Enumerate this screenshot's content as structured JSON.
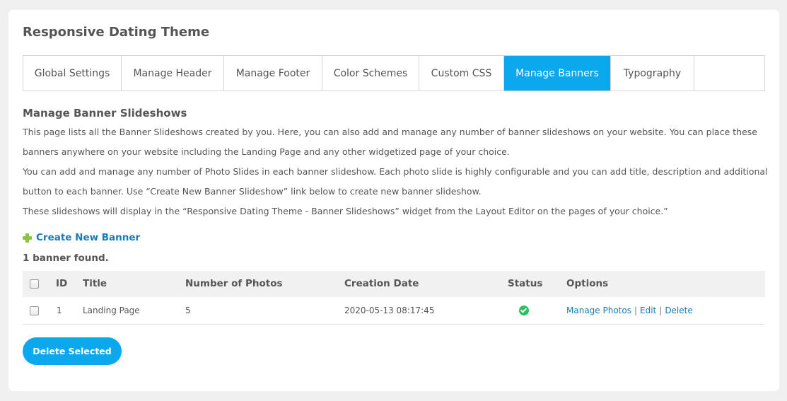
{
  "page_title": "Responsive Dating Theme",
  "tabs": [
    {
      "label": "Global Settings",
      "active": false
    },
    {
      "label": "Manage Header",
      "active": false
    },
    {
      "label": "Manage Footer",
      "active": false
    },
    {
      "label": "Color Schemes",
      "active": false
    },
    {
      "label": "Custom CSS",
      "active": false
    },
    {
      "label": "Manage Banners",
      "active": true
    },
    {
      "label": "Typography",
      "active": false
    }
  ],
  "section": {
    "title": "Manage Banner Slideshows",
    "description": [
      "This page lists all the Banner Slideshows created by you. Here, you can also add and manage any number of banner slideshows on your website. You can place these",
      "banners anywhere on your website including the Landing Page and any other widgetized page of your choice.",
      "You can add and manage any number of Photo Slides in each banner slideshow. Each photo slide is highly configurable and you can add title, description and additional",
      "button to each banner. Use “Create New Banner Slideshow” link below to create new banner slideshow.",
      "These slideshows will display in the “Responsive Dating Theme - Banner Slideshows” widget from the Layout Editor on the pages of your choice.”"
    ]
  },
  "create_link": {
    "label": "Create New Banner",
    "icon": "plus-icon"
  },
  "found_text": "1 banner found.",
  "table": {
    "headers": {
      "id": "ID",
      "title": "Title",
      "photos": "Number of Photos",
      "date": "Creation Date",
      "status": "Status",
      "options": "Options"
    },
    "rows": [
      {
        "id": "1",
        "title": "Landing Page",
        "photos": "5",
        "date": "2020-05-13 08:17:45",
        "status": "enabled",
        "options": [
          "Manage Photos",
          "Edit",
          "Delete"
        ],
        "separator": "|"
      }
    ]
  },
  "delete_button": "Delete Selected",
  "colors": {
    "accent": "#0ca8ee",
    "link": "#1b7ab5",
    "status_ok": "#2dbe60",
    "plus": "#8bc34a"
  }
}
